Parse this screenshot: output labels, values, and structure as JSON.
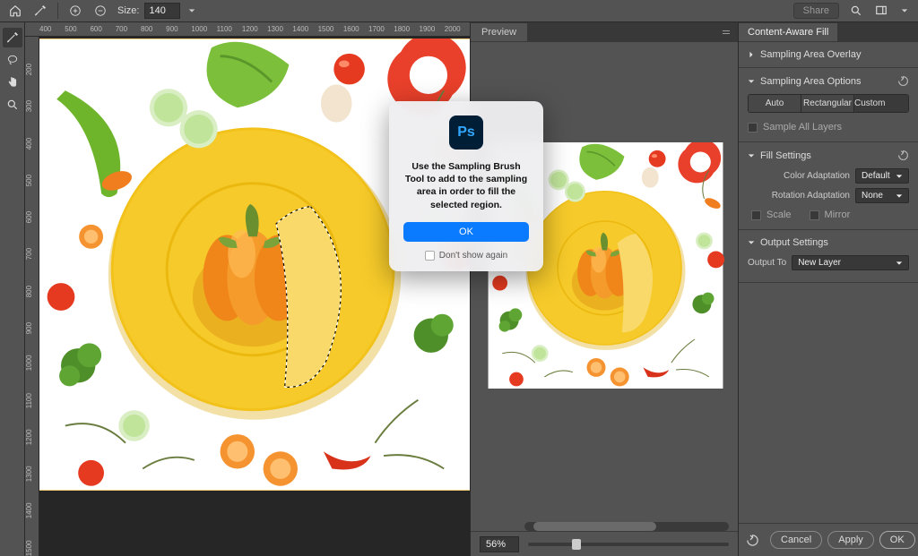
{
  "topbar": {
    "size_label": "Size:",
    "size_value": "140",
    "share": "Share"
  },
  "ruler_h": [
    "400",
    "500",
    "600",
    "700",
    "800",
    "900",
    "1000",
    "1100",
    "1200",
    "1300",
    "1400",
    "1500",
    "1600",
    "1700",
    "1800",
    "1900",
    "2000"
  ],
  "ruler_v": [
    "200",
    "300",
    "400",
    "500",
    "600",
    "700",
    "800",
    "900",
    "1000",
    "1100",
    "1200",
    "1300",
    "1400",
    "1500"
  ],
  "preview": {
    "tab": "Preview",
    "zoom": "56%"
  },
  "panel": {
    "title": "Content-Aware Fill",
    "overlay_section": "Sampling Area Overlay",
    "options_section": "Sampling Area Options",
    "seg_auto": "Auto",
    "seg_rect": "Rectangular",
    "seg_custom": "Custom",
    "sample_all": "Sample All Layers",
    "fill_section": "Fill Settings",
    "color_adapt_label": "Color Adaptation",
    "color_adapt_value": "Default",
    "rotation_label": "Rotation Adaptation",
    "rotation_value": "None",
    "scale": "Scale",
    "mirror": "Mirror",
    "output_section": "Output Settings",
    "output_label": "Output To",
    "output_value": "New Layer",
    "cancel": "Cancel",
    "apply": "Apply",
    "ok": "OK"
  },
  "dialog": {
    "logo": "Ps",
    "message": "Use the Sampling Brush Tool to add to the sampling area in order to fill the selected region.",
    "ok": "OK",
    "dont_show": "Don't show again"
  }
}
